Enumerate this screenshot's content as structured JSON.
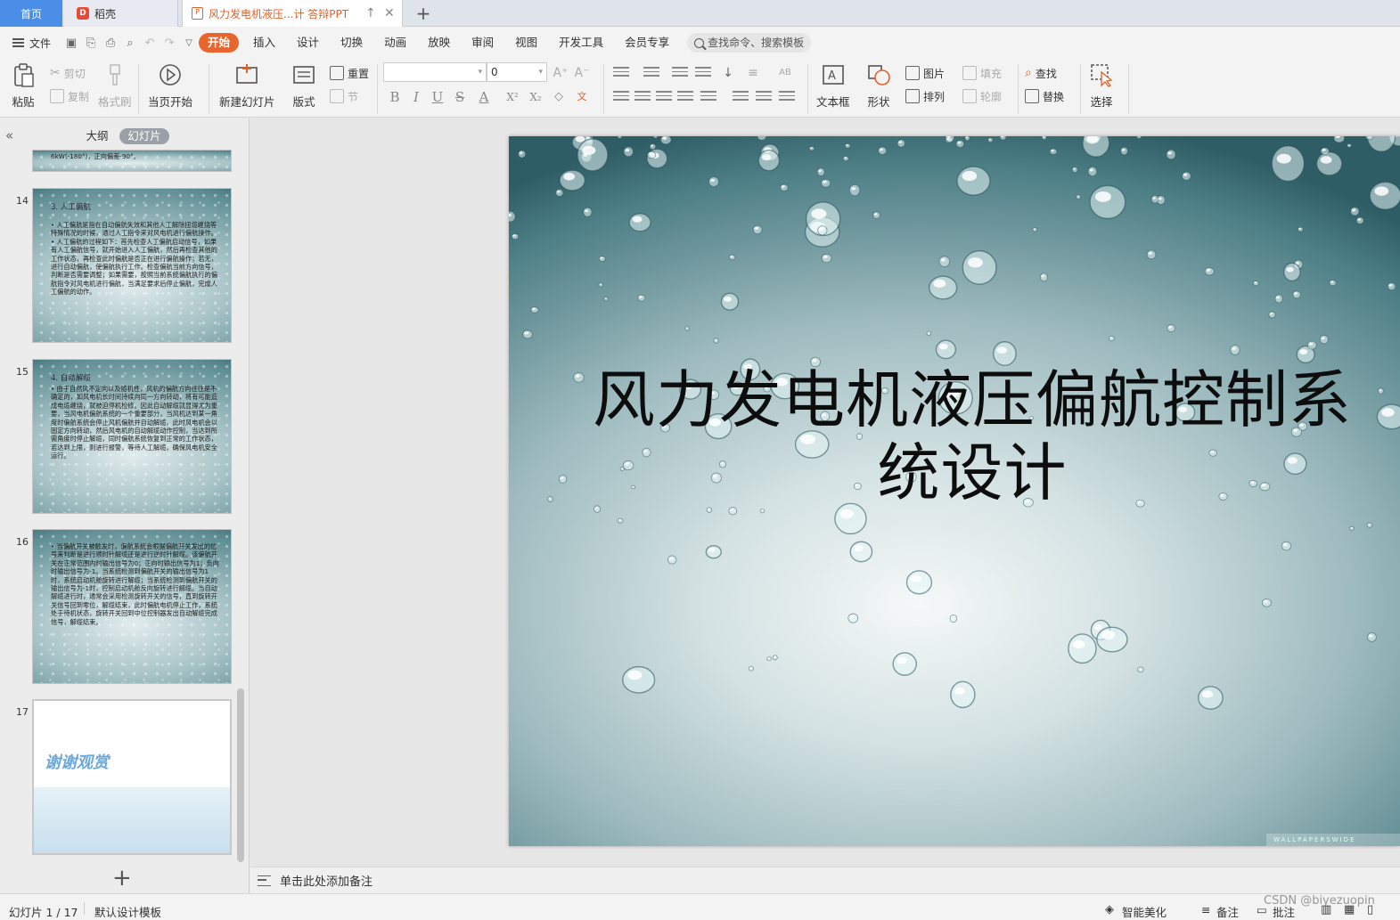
{
  "tabs": {
    "home": "首页",
    "docer": "稻壳",
    "document": "风力发电机液压...计 答辩PPT",
    "new_tab": "+"
  },
  "menu": {
    "file": "文件",
    "tabs": [
      "开始",
      "插入",
      "设计",
      "切换",
      "动画",
      "放映",
      "审阅",
      "视图",
      "开发工具",
      "会员专享"
    ],
    "search_placeholder": "查找命令、搜索模板"
  },
  "ribbon": {
    "paste": "粘贴",
    "cut": "剪切",
    "copy": "复制",
    "format_painter": "格式刷",
    "play_from_current": "当页开始",
    "new_slide": "新建幻灯片",
    "layout": "版式",
    "reset": "重置",
    "section": "节",
    "font_name": "",
    "font_size": "0",
    "text_box": "文本框",
    "shape": "形状",
    "picture": "图片",
    "fill": "填充",
    "arrange": "排列",
    "outline": "轮廓",
    "find": "查找",
    "replace": "替换",
    "select": "选择"
  },
  "left_panel": {
    "tab_outline": "大纲",
    "tab_slides": "幻灯片",
    "slides": [
      {
        "number": "14",
        "title": "3. 人工偏航",
        "text": "• 人工偏航是指在自动偏航失效和其他人工解除扭缆缠绕等特殊情况的时候，通过人工指令来对风电机进行偏航操作。• 人工偏航的过程如下：首先检查人工偏航启动信号，如果有人工偏航信号，就开始进入人工偏航，然后再检查其他的工作状态，再检查此时偏航是否正在进行偏航操作；若无，进行自动偏航，使偏航执行工作。检查偏航当前方向信号，判断是否需要调整；如果需要，按照当前系统偏航执行的偏航指令对风电机进行偏航，当满足要求后停止偏航，完成人工偏航的动作。"
      },
      {
        "number": "15",
        "title": "4. 自动解缆",
        "text": "• 由于自然风不定向以及随机性，风机的偏航方向往往是不确定的，如风电机长时间持续向同一方向转动，将有可能造成电缆缠绕，就被迫停机检修。因此自动解缆就显得尤为重要，当风电机偏航系统的一个重要部分，当风机达到某一角度时偏航系统会停止风机偏航并自动解缆，此时风电机会以固定方向转动，然后风电机的自动解缆动作控制，当达到所需角度时停止解缆，同时偏航系统恢复到正常的工作状态，若达到上限，则进行报警，等待人工解缆，确保风电机安全运行。"
      },
      {
        "number": "16",
        "title": "",
        "text": "• 当偏航开关被触发时，偏航系统会根据偏航开关发出的信号来判断是进行顺时针解缆还是进行逆时针解缆。该偏航开关在正常范围内时输出信号为0；正向时输出信号为1；负向时输出信号为-1。当系统检测到偏航开关的输出信号为1时，系统启动机舱旋转进行解缆；当系统检测到偏航开关的输出信号为-1时，控制启动机舱反向旋转进行解缆。当自动解缆进行时，通常会采用检测旋转开关的信号，直到旋转开关信号回到零位，解缆结束，此时偏航电机停止工作，系统处于待机状态，旋转开关回到中位控制器发出自动解缆完成信号，解缆结束。"
      },
      {
        "number": "17",
        "title": "谢谢观赏",
        "text": ""
      }
    ],
    "partial_slide_text": "6kW(-180°)，正向偏差-90°。"
  },
  "slide": {
    "title": "风力发电机液压偏航控制系统设计",
    "watermark": "WALLPAPERSWIDE"
  },
  "notes": {
    "placeholder": "单击此处添加备注"
  },
  "statusbar": {
    "slide_counter": "幻灯片 1 / 17",
    "template": "默认设计模板",
    "smart_beautify": "智能美化",
    "notes": "备注",
    "comments": "批注",
    "watermark": "CSDN @biyezuopin"
  },
  "colors": {
    "accent": "#e8652d",
    "home_tab": "#4a8ee8",
    "thanks_text": "#6ea8d6"
  }
}
